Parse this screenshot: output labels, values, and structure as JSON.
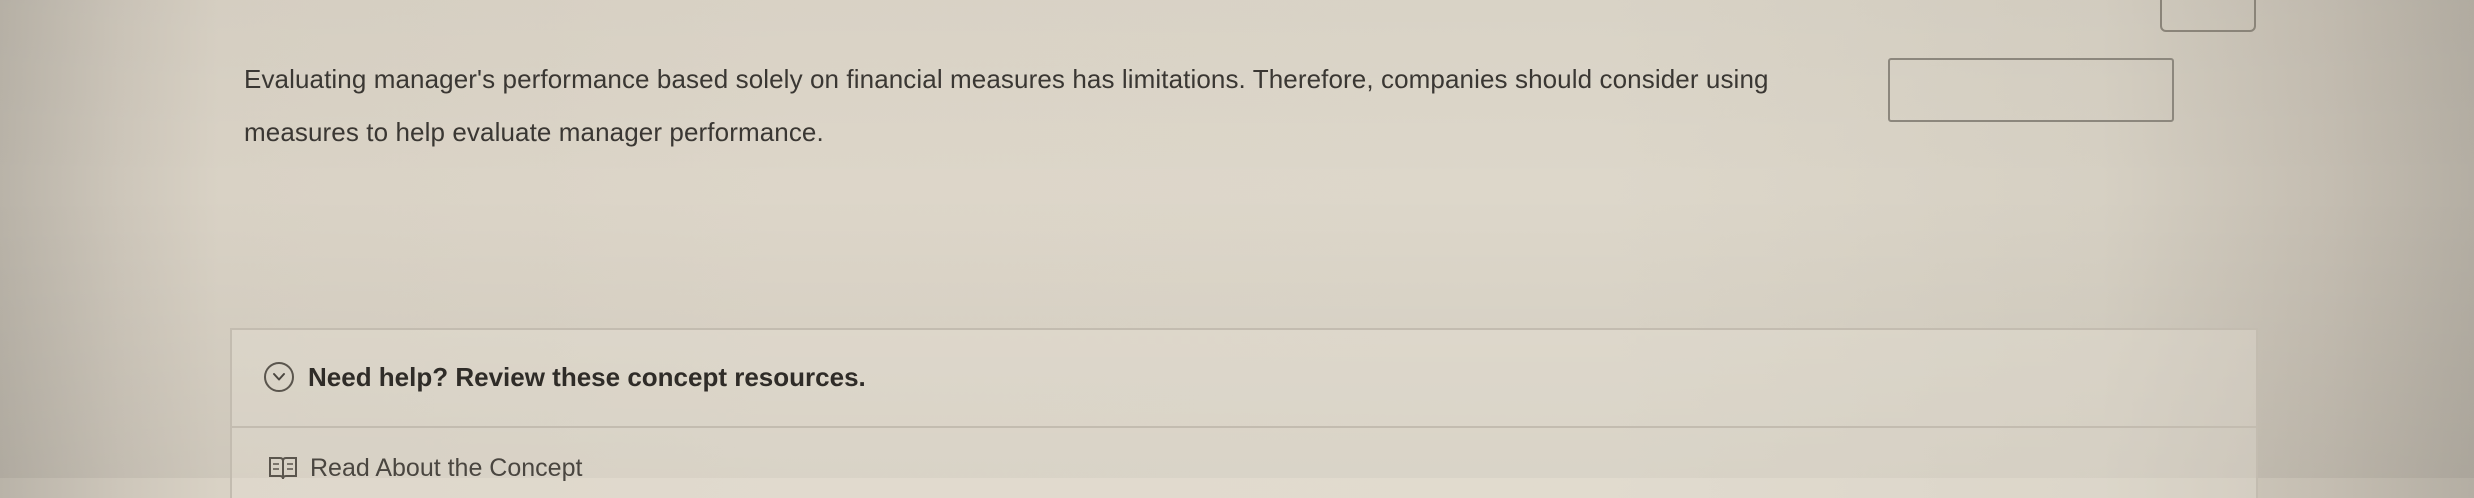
{
  "question": {
    "line1": "Evaluating manager's performance based solely on financial measures has limitations. Therefore, companies should consider using",
    "line2": "measures to help evaluate manager performance.",
    "answer_value": "",
    "answer_placeholder": ""
  },
  "help": {
    "title": "Need help? Review these concept resources.",
    "toggle_icon": "chevron-down-circle-icon",
    "resources": [
      {
        "label": "Read About the Concept",
        "icon": "book-icon"
      }
    ]
  }
}
